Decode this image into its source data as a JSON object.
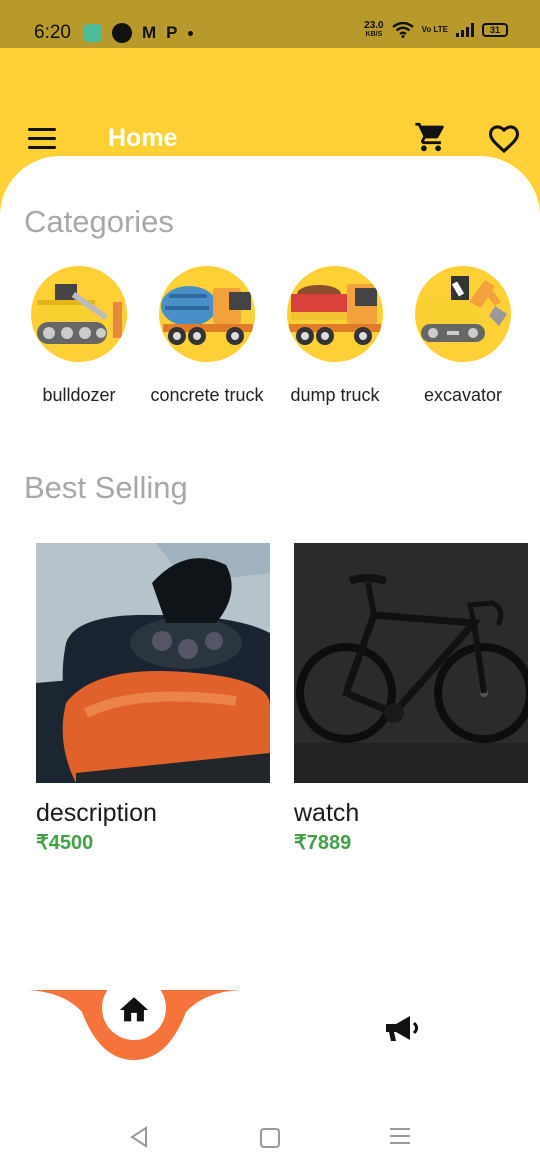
{
  "status_bar": {
    "time": "6:20",
    "notif_m": "M",
    "notif_p": "P",
    "speed_value": "23.0",
    "speed_unit": "KB/S",
    "volte": "Vo LTE",
    "battery": "31"
  },
  "app_bar": {
    "title": "Home",
    "menu_icon": "hamburger-menu-icon",
    "cart_icon": "shopping-cart-icon",
    "favorites_icon": "heart-outline-icon",
    "background_color": "#fdd036"
  },
  "categories": {
    "title": "Categories",
    "items": [
      {
        "label": "bulldozer",
        "icon": "bulldozer-icon"
      },
      {
        "label": "concrete truck",
        "icon": "concrete-truck-icon"
      },
      {
        "label": "dump truck",
        "icon": "dump-truck-icon"
      },
      {
        "label": "excavator",
        "icon": "excavator-icon"
      }
    ]
  },
  "best_selling": {
    "title": "Best Selling",
    "products": [
      {
        "name": "description",
        "price": "₹4500",
        "image": "orange-motorcycle-tank-photo"
      },
      {
        "name": "watch",
        "price": "₹7889",
        "image": "black-road-bicycle-photo"
      }
    ],
    "price_color": "#43a047"
  },
  "bottom_nav": {
    "active_tab": "home",
    "tabs": [
      {
        "icon": "home-icon"
      },
      {
        "icon": "megaphone-icon"
      }
    ],
    "active_color": "#f4743b"
  },
  "system_nav": [
    "back-icon",
    "home-square-icon",
    "recents-menu-icon"
  ]
}
